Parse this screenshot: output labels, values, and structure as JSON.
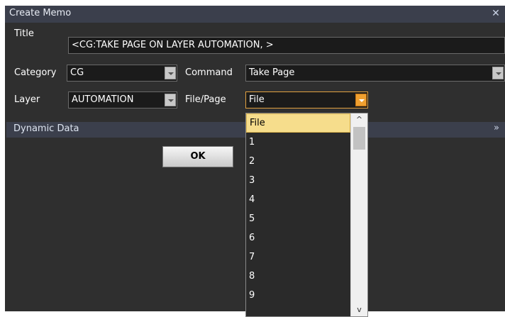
{
  "window": {
    "title": "Create Memo"
  },
  "form": {
    "title_label": "Title",
    "title_value": "<CG:TAKE PAGE ON LAYER AUTOMATION, >",
    "category_label": "Category",
    "category_value": "CG",
    "command_label": "Command",
    "command_value": "Take Page",
    "layer_label": "Layer",
    "layer_value": "AUTOMATION",
    "filepage_label": "File/Page",
    "filepage_value": "File"
  },
  "section": {
    "label": "Dynamic Data"
  },
  "buttons": {
    "ok_label": "OK"
  },
  "dropdown": {
    "options": [
      "File",
      "1",
      "2",
      "3",
      "4",
      "5",
      "6",
      "7",
      "8",
      "9"
    ],
    "selected": "File"
  },
  "icons": {
    "close": "close-icon",
    "expand": "double-chevron-down-icon",
    "dropdown": "chevron-down-icon",
    "scroll_up": "scroll-up-icon",
    "scroll_down": "scroll-down-icon"
  },
  "colors": {
    "background": "#2f2f2f",
    "titlebar": "#3b3f4c",
    "active_dropdown_button": "#f0a030",
    "selected_option": "#f6dd8c"
  }
}
